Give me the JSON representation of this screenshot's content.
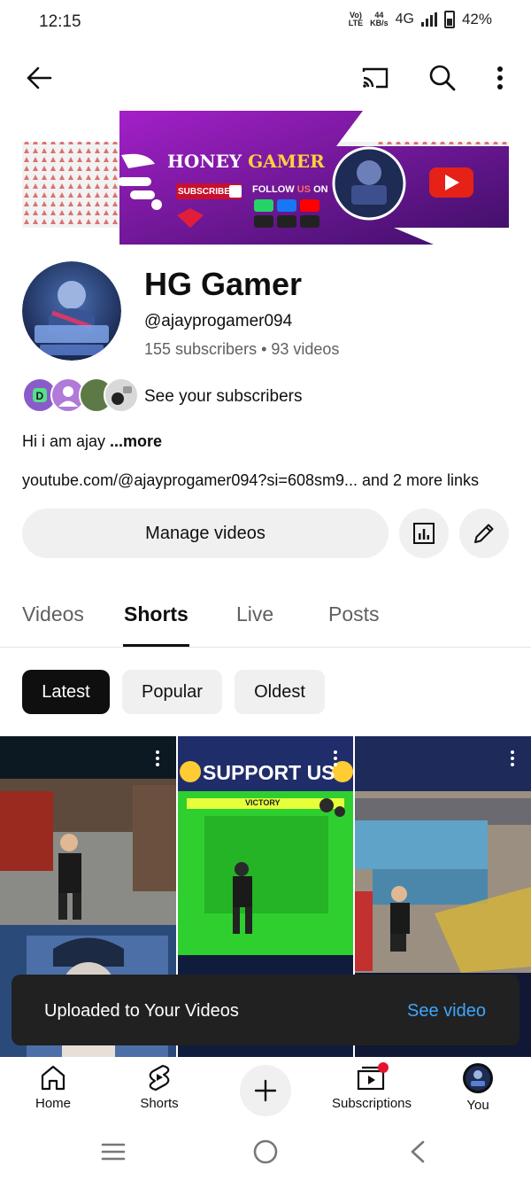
{
  "status_bar": {
    "time": "12:15",
    "volte_top": "Vo)",
    "volte_bottom": "LTE",
    "speed_value": "44",
    "speed_unit": "KB/s",
    "network": "4G",
    "battery": "42%"
  },
  "top_bar": {
    "back_icon": "back-arrow-icon",
    "cast_icon": "cast-icon",
    "search_icon": "search-icon",
    "more_icon": "more-vert-icon"
  },
  "banner": {
    "title_part1": "HONEY ",
    "title_part2": "GAMER",
    "subscribed_label": "SUBSCRIBED",
    "follow_part1": "FOLLOW ",
    "follow_part2": "US ",
    "follow_part3": "ON"
  },
  "channel": {
    "name": "HG Gamer",
    "handle": "@ajayprogamer094",
    "stats": "155 subscribers • 93 videos",
    "see_subscribers": "See your subscribers",
    "description": "Hi i am ajay ",
    "description_more": "...more",
    "links": "youtube.com/@ajayprogamer094?si=608sm9... and 2 more links"
  },
  "actions": {
    "manage_videos": "Manage videos",
    "analytics_icon": "analytics-icon",
    "edit_icon": "edit-pencil-icon"
  },
  "tabs": [
    {
      "label": "Videos",
      "active": false
    },
    {
      "label": "Shorts",
      "active": true
    },
    {
      "label": "Live",
      "active": false
    },
    {
      "label": "Posts",
      "active": false
    }
  ],
  "chips": [
    {
      "label": "Latest",
      "active": true
    },
    {
      "label": "Popular",
      "active": false
    },
    {
      "label": "Oldest",
      "active": false
    }
  ],
  "shorts": [
    {
      "overlay_text": ""
    },
    {
      "overlay_text": "SUPPORT US",
      "caption": "VICTORY"
    },
    {
      "overlay_text": ""
    }
  ],
  "snackbar": {
    "message": "Uploaded to Your Videos",
    "action": "See video"
  },
  "bottom_nav": [
    {
      "label": "Home",
      "icon": "home-icon"
    },
    {
      "label": "Shorts",
      "icon": "shorts-icon"
    },
    {
      "label": "",
      "icon": "create-plus-icon"
    },
    {
      "label": "Subscriptions",
      "icon": "subscriptions-icon"
    },
    {
      "label": "You",
      "icon": "profile-avatar"
    }
  ],
  "colors": {
    "brand_red": "#ff0000",
    "link_blue": "#3ea6ff",
    "chip_active": "#0f0f0f",
    "chip_bg": "#f0f0f0",
    "banner_purple": "#7a1fa0"
  }
}
